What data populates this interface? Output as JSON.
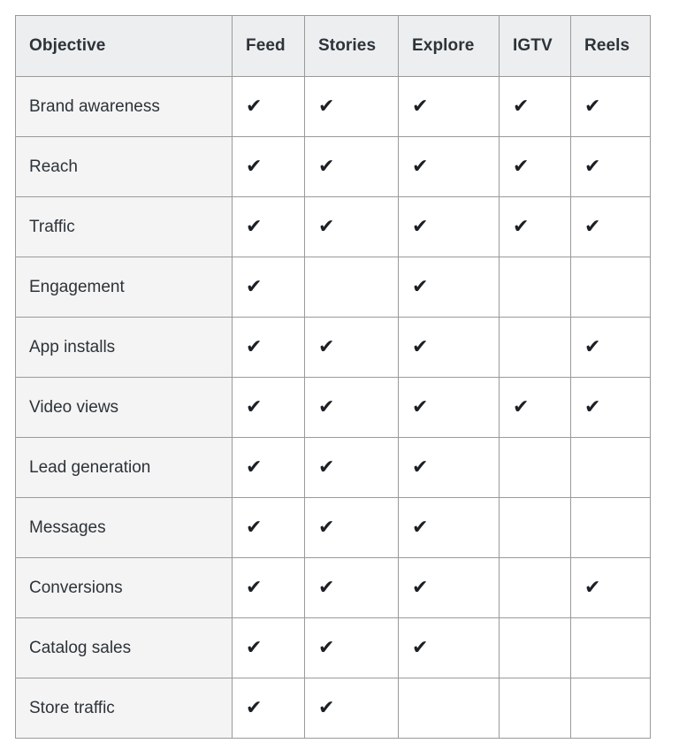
{
  "table": {
    "name": "instagram-placement-objective-matrix",
    "columns": [
      {
        "key": "objective",
        "label": "Objective"
      },
      {
        "key": "feed",
        "label": "Feed"
      },
      {
        "key": "stories",
        "label": "Stories"
      },
      {
        "key": "explore",
        "label": "Explore"
      },
      {
        "key": "igtv",
        "label": "IGTV"
      },
      {
        "key": "reels",
        "label": "Reels"
      }
    ],
    "check_glyph": "✔",
    "check_icon_name": "checkmark-icon",
    "colors": {
      "border": "#9a9a9a",
      "header_bg": "#eceef0",
      "first_column_bg": "#f4f4f5",
      "cell_bg": "#ffffff",
      "text": "#2d3338",
      "check": "#1c2024"
    },
    "rows": [
      {
        "objective": "Brand awareness",
        "feed": true,
        "stories": true,
        "explore": true,
        "igtv": true,
        "reels": true
      },
      {
        "objective": "Reach",
        "feed": true,
        "stories": true,
        "explore": true,
        "igtv": true,
        "reels": true
      },
      {
        "objective": "Traffic",
        "feed": true,
        "stories": true,
        "explore": true,
        "igtv": true,
        "reels": true
      },
      {
        "objective": "Engagement",
        "feed": true,
        "stories": false,
        "explore": true,
        "igtv": false,
        "reels": false
      },
      {
        "objective": "App installs",
        "feed": true,
        "stories": true,
        "explore": true,
        "igtv": false,
        "reels": true
      },
      {
        "objective": "Video views",
        "feed": true,
        "stories": true,
        "explore": true,
        "igtv": true,
        "reels": true
      },
      {
        "objective": "Lead generation",
        "feed": true,
        "stories": true,
        "explore": true,
        "igtv": false,
        "reels": false
      },
      {
        "objective": "Messages",
        "feed": true,
        "stories": true,
        "explore": true,
        "igtv": false,
        "reels": false
      },
      {
        "objective": "Conversions",
        "feed": true,
        "stories": true,
        "explore": true,
        "igtv": false,
        "reels": true
      },
      {
        "objective": "Catalog sales",
        "feed": true,
        "stories": true,
        "explore": true,
        "igtv": false,
        "reels": false
      },
      {
        "objective": "Store traffic",
        "feed": true,
        "stories": true,
        "explore": false,
        "igtv": false,
        "reels": false
      }
    ]
  }
}
